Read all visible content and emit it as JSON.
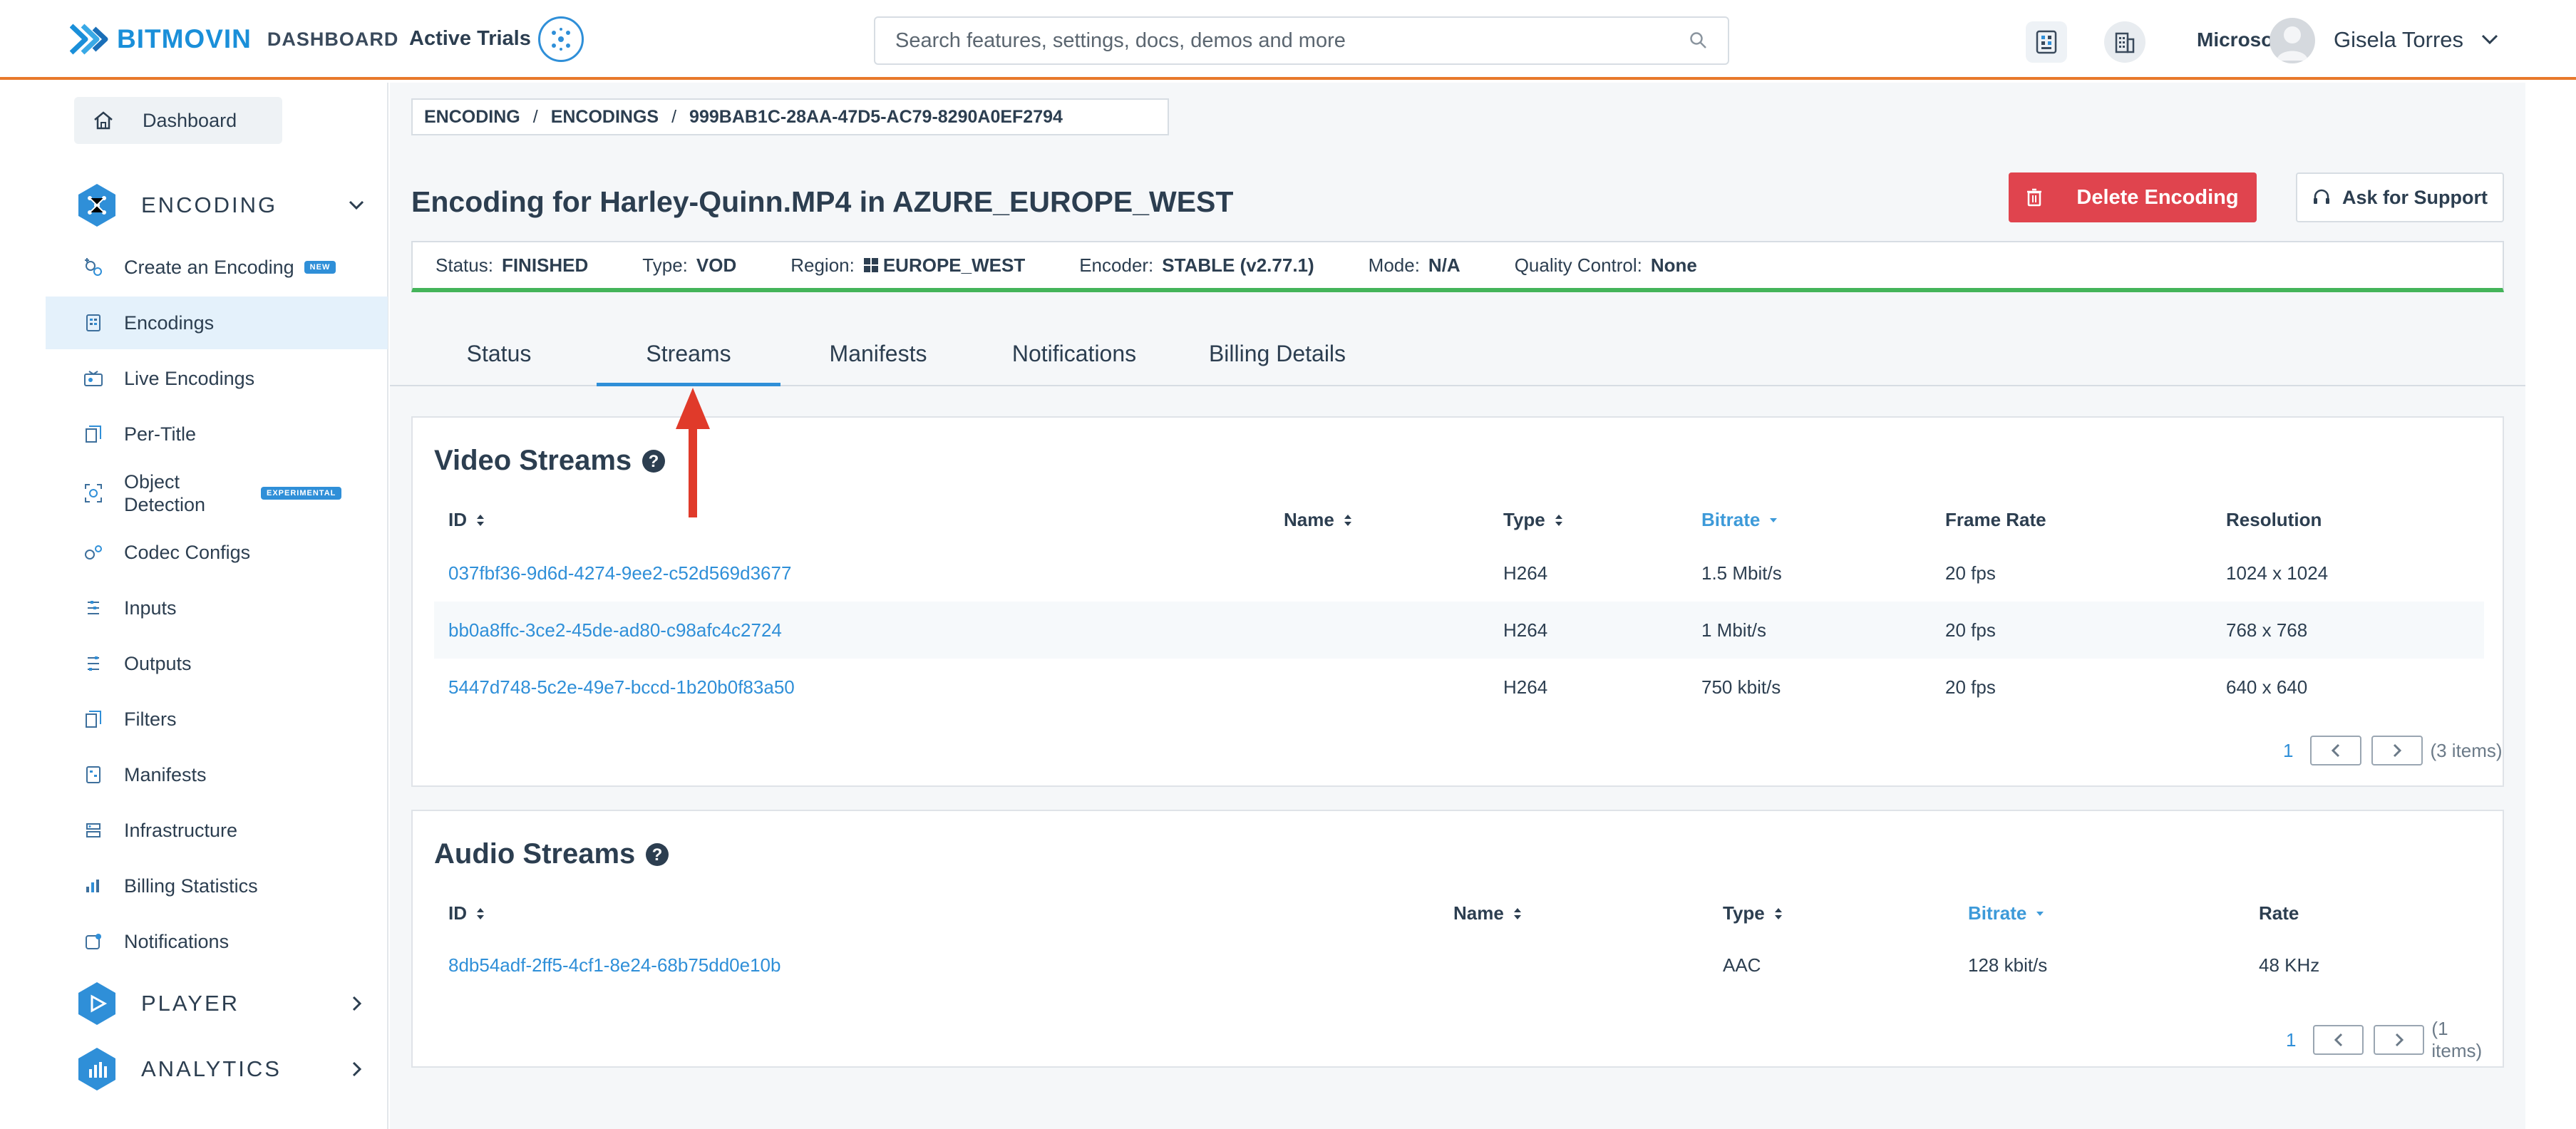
{
  "header": {
    "logo_text": "BITMOVIN",
    "logo_sub": "DASHBOARD",
    "active_trials": "Active Trials",
    "search_placeholder": "Search features, settings, docs, demos and more",
    "org_name": "Microsoft",
    "user_name": "Gisela Torres"
  },
  "sidebar": {
    "dashboard": "Dashboard",
    "encoding_section": "ENCODING",
    "items": [
      {
        "label": "Create an Encoding",
        "badge": "NEW",
        "icon": "create-encoding-icon"
      },
      {
        "label": "Encodings",
        "icon": "encodings-icon"
      },
      {
        "label": "Live Encodings",
        "icon": "live-encodings-icon"
      },
      {
        "label": "Per-Title",
        "icon": "per-title-icon"
      },
      {
        "label": "Object Detection",
        "badge": "EXPERIMENTAL",
        "icon": "object-detection-icon"
      },
      {
        "label": "Codec Configs",
        "icon": "codec-configs-icon"
      },
      {
        "label": "Inputs",
        "icon": "inputs-icon"
      },
      {
        "label": "Outputs",
        "icon": "outputs-icon"
      },
      {
        "label": "Filters",
        "icon": "filters-icon"
      },
      {
        "label": "Manifests",
        "icon": "manifests-icon"
      },
      {
        "label": "Infrastructure",
        "icon": "infrastructure-icon"
      },
      {
        "label": "Billing Statistics",
        "icon": "billing-statistics-icon"
      },
      {
        "label": "Notifications",
        "icon": "notifications-icon"
      }
    ],
    "player_section": "PLAYER",
    "analytics_section": "ANALYTICS"
  },
  "breadcrumb": [
    "ENCODING",
    "ENCODINGS",
    "999BAB1C-28AA-47D5-AC79-8290A0EF2794"
  ],
  "breadcrumb_sep": "/",
  "page": {
    "title": "Encoding for Harley-Quinn.MP4 in AZURE_EUROPE_WEST",
    "delete_button": "Delete Encoding",
    "support_button": "Ask for Support"
  },
  "status": {
    "status_label": "Status:",
    "status_value": "FINISHED",
    "type_label": "Type:",
    "type_value": "VOD",
    "region_label": "Region:",
    "region_value": "EUROPE_WEST",
    "encoder_label": "Encoder:",
    "encoder_value": "STABLE (v2.77.1)",
    "mode_label": "Mode:",
    "mode_value": "N/A",
    "qc_label": "Quality Control:",
    "qc_value": "None"
  },
  "tabs": [
    "Status",
    "Streams",
    "Manifests",
    "Notifications",
    "Billing Details"
  ],
  "active_tab": "Streams",
  "video": {
    "title": "Video Streams",
    "columns": [
      "ID",
      "Name",
      "Type",
      "Bitrate",
      "Frame Rate",
      "Resolution"
    ],
    "rows": [
      {
        "id": "037fbf36-9d6d-4274-9ee2-c52d569d3677",
        "name": "",
        "type": "H264",
        "bitrate": "1.5 Mbit/s",
        "frame_rate": "20 fps",
        "resolution": "1024 x 1024"
      },
      {
        "id": "bb0a8ffc-3ce2-45de-ad80-c98afc4c2724",
        "name": "",
        "type": "H264",
        "bitrate": "1 Mbit/s",
        "frame_rate": "20 fps",
        "resolution": "768 x 768"
      },
      {
        "id": "5447d748-5c2e-49e7-bccd-1b20b0f83a50",
        "name": "",
        "type": "H264",
        "bitrate": "750 kbit/s",
        "frame_rate": "20 fps",
        "resolution": "640 x 640"
      }
    ],
    "page": "1",
    "count": "(3 items)"
  },
  "audio": {
    "title": "Audio Streams",
    "columns": [
      "ID",
      "Name",
      "Type",
      "Bitrate",
      "Rate"
    ],
    "rows": [
      {
        "id": "8db54adf-2ff5-4cf1-8e24-68b75dd0e10b",
        "name": "",
        "type": "AAC",
        "bitrate": "128 kbit/s",
        "rate": "48 KHz"
      }
    ],
    "page": "1",
    "count": "(1 items)"
  },
  "colors": {
    "accent": "#2f8fd8",
    "header_border": "#e8792b",
    "delete": "#e0444e",
    "status_ok": "#44b45a",
    "arrow": "#e03a2a"
  }
}
